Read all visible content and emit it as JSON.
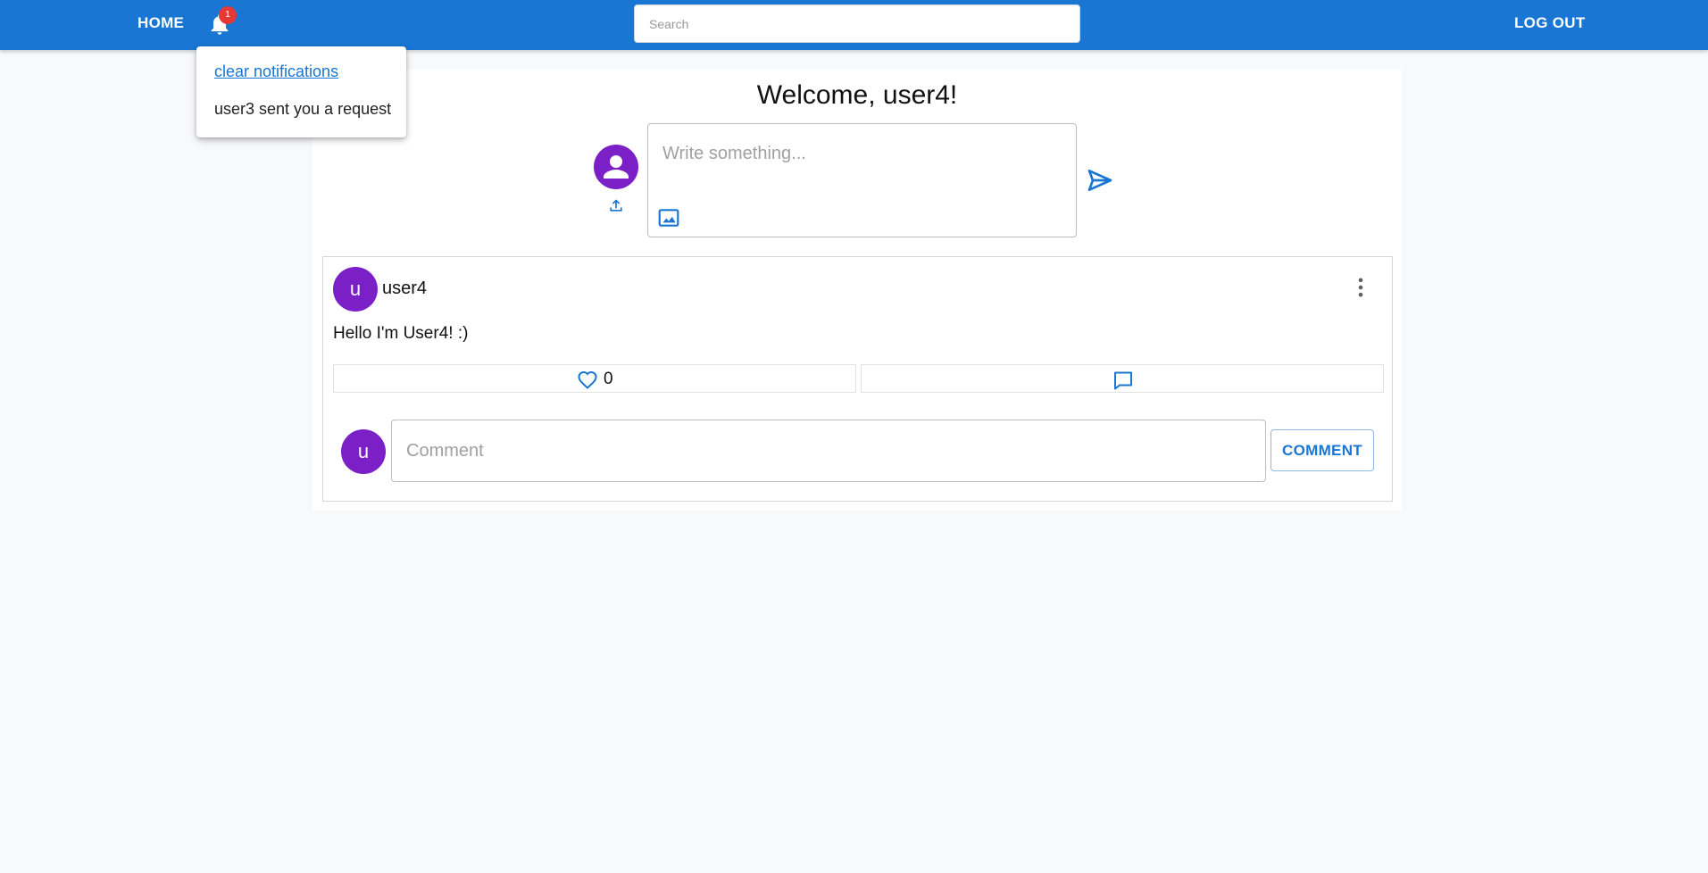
{
  "header": {
    "home_label": "HOME",
    "notification_count": "1",
    "search_placeholder": "Search",
    "logout_label": "LOG OUT"
  },
  "notifications": {
    "clear_label": "clear notifications",
    "items": [
      "user3 sent you a request"
    ]
  },
  "composer": {
    "welcome": "Welcome, user4!",
    "placeholder": "Write something..."
  },
  "post": {
    "avatar_letter": "u",
    "username": "user4",
    "text": "Hello I'm User4! :)",
    "like_count": "0"
  },
  "comment": {
    "avatar_letter": "u",
    "placeholder": "Comment",
    "button_label": "COMMENT"
  },
  "colors": {
    "primary": "#1976d2",
    "avatar": "#7b1fc7",
    "badge": "#e53935",
    "background": "#f8f9fb"
  },
  "icons": [
    "bell-icon",
    "person-icon",
    "upload-icon",
    "image-icon",
    "send-icon",
    "more-vert-icon",
    "heart-outline-icon",
    "comment-icon"
  ]
}
